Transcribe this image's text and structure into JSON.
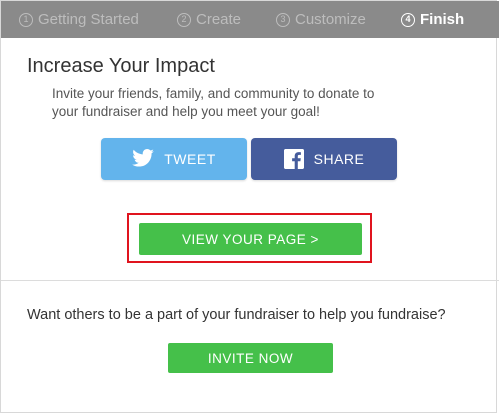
{
  "steps": [
    {
      "number": "1",
      "label": "Getting Started",
      "active": false
    },
    {
      "number": "2",
      "label": "Create",
      "active": false
    },
    {
      "number": "3",
      "label": "Customize",
      "active": false
    },
    {
      "number": "4",
      "label": "Finish",
      "active": true
    }
  ],
  "impact": {
    "title": "Increase Your Impact",
    "description": "Invite your friends, family, and community to donate to your fundraiser and help you meet your goal!"
  },
  "social": {
    "tweet_label": "TWEET",
    "tweet_icon": "twitter-bird-icon",
    "tweet_color": "#63b4ec",
    "share_label": "SHARE",
    "share_icon": "facebook-icon",
    "share_color": "#455c9c"
  },
  "view_page": {
    "label": "VIEW YOUR PAGE >",
    "color": "#45c04a",
    "highlight_color": "#e0141e"
  },
  "invite": {
    "prompt": "Want others to be a part of your fundraiser to help you fundraise?",
    "button_label": "INVITE NOW",
    "color": "#45c04a"
  },
  "colors": {
    "steps_bar": "#8a8a8a",
    "step_inactive_text": "#bdbdbd",
    "step_active_text": "#ffffff"
  }
}
